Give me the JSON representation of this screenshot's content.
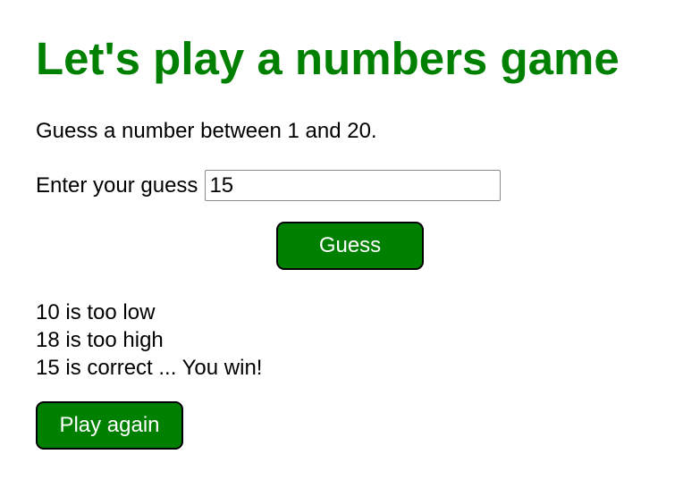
{
  "heading": "Let's play a numbers game",
  "instructions": "Guess a number between 1 and 20.",
  "guess_form": {
    "label": "Enter your guess",
    "input_value": "15",
    "button_label": "Guess"
  },
  "results": [
    "10 is too low",
    "18 is too high",
    "15 is correct ... You win!"
  ],
  "play_again_label": "Play again",
  "colors": {
    "accent": "#008000",
    "button_border": "#000000",
    "button_text": "#ffffff"
  }
}
